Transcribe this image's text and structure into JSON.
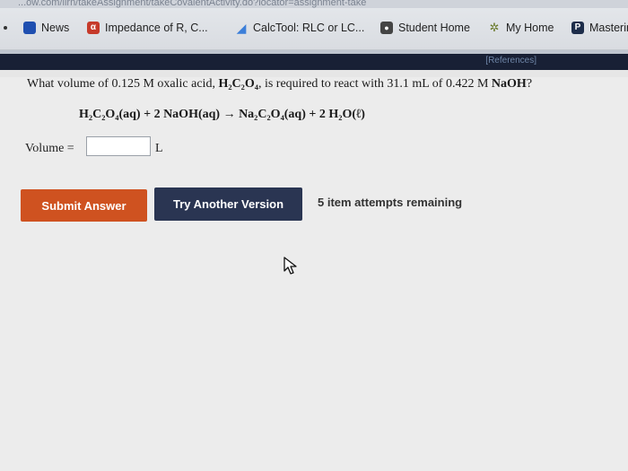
{
  "url_fragment": "...ow.com/ilrn/takeAssignment/takeCovalentActivity.do?locator=assignment-take",
  "bookmarks": [
    {
      "label": "News",
      "icon": "news-icon"
    },
    {
      "label": "Impedance of R, C...",
      "icon": "impedance-icon"
    },
    {
      "label": "CalcTool: RLC or LC...",
      "icon": "calctool-icon"
    },
    {
      "label": "Student Home",
      "icon": "student-home-icon"
    },
    {
      "label": "My Home",
      "icon": "my-home-icon"
    },
    {
      "label": "Masterin",
      "icon": "mastering-icon"
    }
  ],
  "references_label": "[References]",
  "question": {
    "prefix": "What volume of 0.125 M oxalic acid, ",
    "formula": "H₂C₂O₄",
    "middle": ", is required to react with 31.1 mL of 0.422 M ",
    "reagent": "NaOH",
    "suffix": "?"
  },
  "equation": "H₂C₂O₄(aq) + 2 NaOH(aq) → Na₂C₂O₄(aq) + 2 H₂O(ℓ)",
  "answer": {
    "label": "Volume =",
    "value": "",
    "unit": "L"
  },
  "buttons": {
    "submit": "Submit Answer",
    "try_another": "Try Another Version"
  },
  "attempts_text": "5 item attempts remaining",
  "colors": {
    "submit_bg": "#cf5220",
    "try_bg": "#2a3552",
    "refbar_bg": "#182035"
  }
}
